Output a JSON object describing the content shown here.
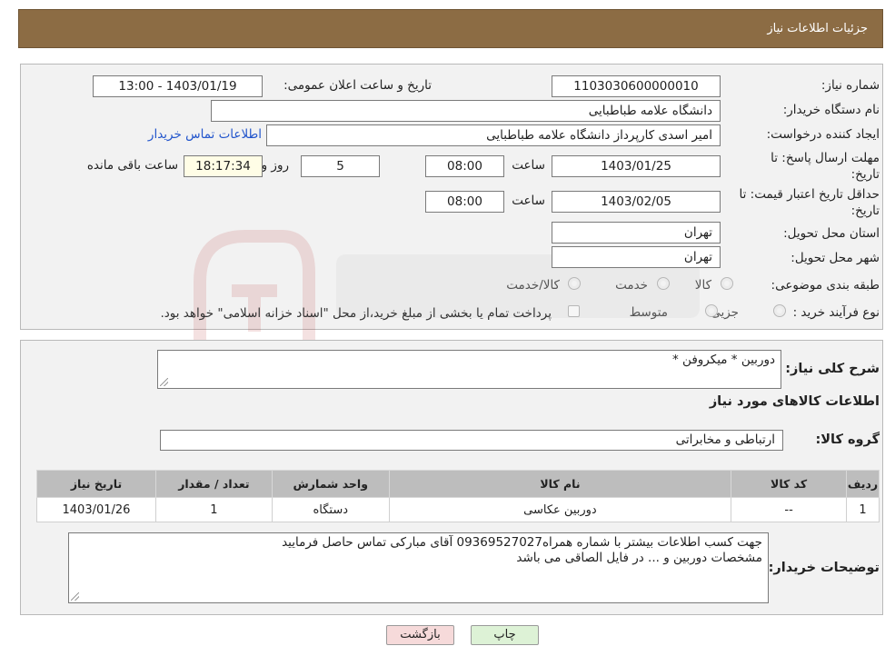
{
  "header": {
    "title": "جزئیات اطلاعات نیاز"
  },
  "need": {
    "number_label": "شماره نیاز:",
    "number": "1103030600000010",
    "announce_label": "تاریخ و ساعت اعلان عمومی:",
    "announce_value": "1403/01/19 - 13:00",
    "buyer_label": "نام دستگاه خریدار:",
    "buyer": "دانشگاه علامه طباطبایی",
    "creator_label": "ایجاد کننده درخواست:",
    "creator": "امیر اسدی کارپرداز دانشگاه علامه طباطبایی",
    "contact_link": "اطلاعات تماس خریدار",
    "deadline_label_1": "مهلت ارسال پاسخ: تا",
    "deadline_label_2": "تاریخ:",
    "deadline_date": "1403/01/25",
    "time_label": "ساعت",
    "deadline_time": "08:00",
    "days_value": "5",
    "days_label": "روز و",
    "remaining_time": "18:17:34",
    "remaining_label": "ساعت باقی مانده",
    "validity_label_1": "حداقل تاریخ اعتبار قیمت: تا",
    "validity_label_2": "تاریخ:",
    "validity_date": "1403/02/05",
    "validity_time": "08:00",
    "province_label": "استان محل تحویل:",
    "province": "تهران",
    "city_label": "شهر محل تحویل:",
    "city": "تهران",
    "category_label": "طبقه بندی موضوعی:",
    "category_options": [
      "کالا",
      "خدمت",
      "کالا/خدمت"
    ],
    "process_label": "نوع فرآیند خرید :",
    "process_options": [
      "جزیی",
      "متوسط"
    ],
    "payment_note": "پرداخت تمام یا بخشی از مبلغ خرید،از محل \"اسناد خزانه اسلامی\" خواهد بود."
  },
  "description": {
    "label": "شرح کلی نیاز:",
    "value": "دوربین * میکروفن *"
  },
  "goods": {
    "section_title": "اطلاعات کالاهای مورد نیاز",
    "group_label": "گروه کالا:",
    "group_value": "ارتباطی و مخابراتی",
    "columns": [
      "ردیف",
      "کد کالا",
      "نام کالا",
      "واحد شمارش",
      "تعداد / مقدار",
      "تاریخ نیاز"
    ],
    "rows": [
      [
        "1",
        "--",
        "دوربین عکاسی",
        "دستگاه",
        "1",
        "1403/01/26"
      ]
    ]
  },
  "buyer_notes": {
    "label": "توضیحات خریدار:",
    "line1": "جهت کسب اطلاعات بیشتر با شماره همراه09369527027 آقای مبارکی تماس حاصل فرمایید",
    "line2": "مشخصات دوربین و ... در فایل الصاقی می باشد"
  },
  "buttons": {
    "print": "چاپ",
    "back": "بازگشت"
  },
  "colors": {
    "header": "#8c6c44",
    "panel": "#f2f2f2",
    "table_header": "#bdbdbd",
    "link": "#2255cc"
  }
}
